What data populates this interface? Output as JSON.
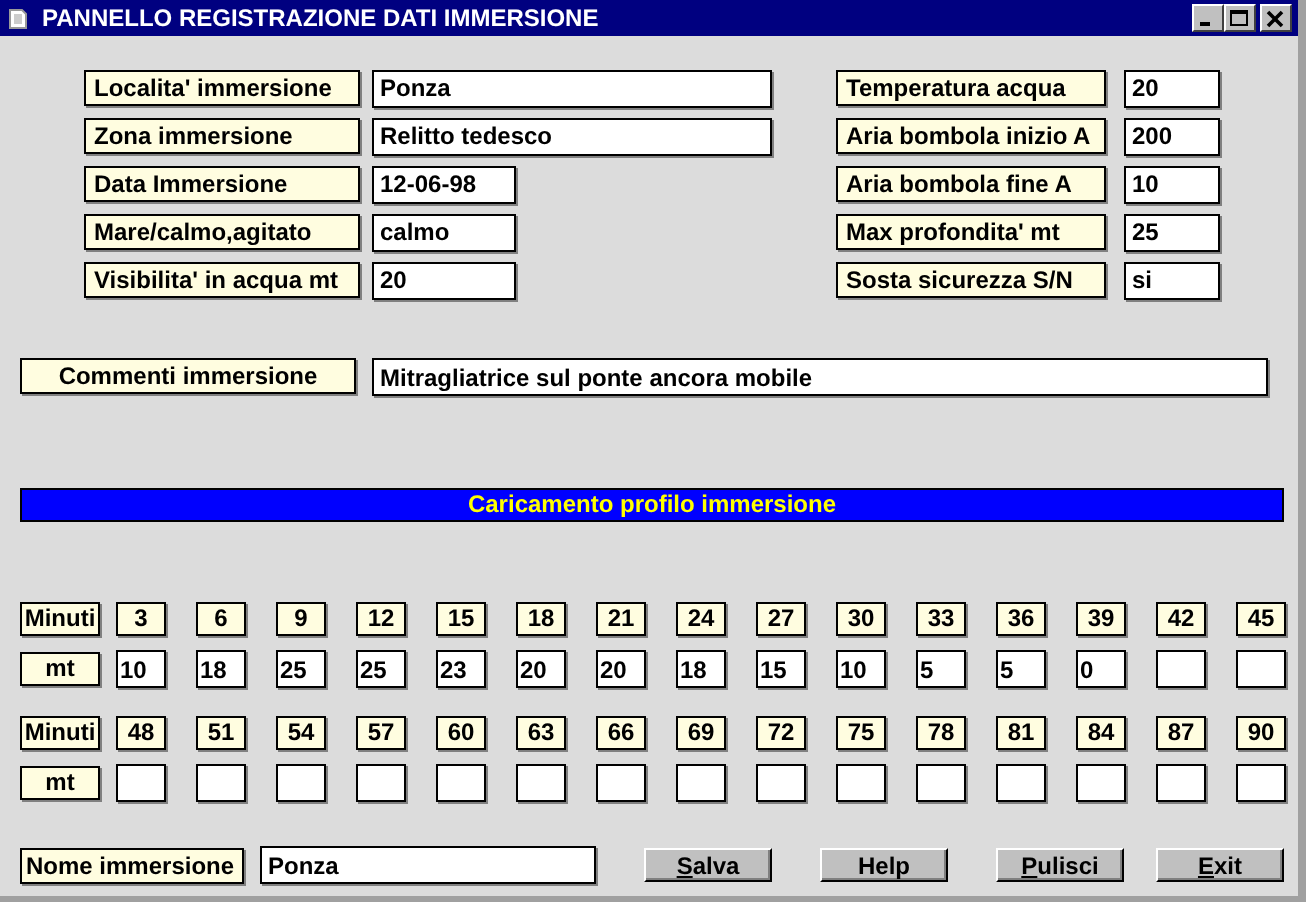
{
  "window": {
    "title": "PANNELLO REGISTRAZIONE DATI IMMERSIONE"
  },
  "left_fields": [
    {
      "label": "Localita' immersione",
      "value": "Ponza",
      "kind": "long"
    },
    {
      "label": "Zona immersione",
      "value": "Relitto tedesco",
      "kind": "long"
    },
    {
      "label": "Data Immersione",
      "value": "12-06-98",
      "kind": "short"
    },
    {
      "label": "Mare/calmo,agitato",
      "value": "calmo",
      "kind": "short"
    },
    {
      "label": "Visibilita' in acqua mt",
      "value": "20",
      "kind": "short"
    }
  ],
  "right_fields": [
    {
      "label": "Temperatura acqua",
      "value": "20"
    },
    {
      "label": "Aria bombola inizio A",
      "value": "200"
    },
    {
      "label": "Aria bombola fine A",
      "value": "10"
    },
    {
      "label": "Max profondita' mt",
      "value": "25"
    },
    {
      "label": "Sosta sicurezza S/N",
      "value": "si"
    }
  ],
  "comment": {
    "label": "Commenti immersione",
    "value": "Mitragliatrice sul ponte ancora mobile"
  },
  "section_header": "Caricamento profilo immersione",
  "profile_blocks": [
    {
      "minutes_label": "Minuti",
      "depth_label": "mt",
      "minutes": [
        "3",
        "6",
        "9",
        "12",
        "15",
        "18",
        "21",
        "24",
        "27",
        "30",
        "33",
        "36",
        "39",
        "42",
        "45"
      ],
      "depths": [
        "10",
        "18",
        "25",
        "25",
        "23",
        "20",
        "20",
        "18",
        "15",
        "10",
        "5",
        "5",
        "0"
      ]
    },
    {
      "minutes_label": "Minuti",
      "depth_label": "mt",
      "minutes": [
        "48",
        "51",
        "54",
        "57",
        "60",
        "63",
        "66",
        "69",
        "72",
        "75",
        "78",
        "81",
        "84",
        "87",
        "90"
      ]
    }
  ],
  "name_field": {
    "label": "Nome immersione",
    "value": "Ponza"
  },
  "buttons": [
    {
      "label": "Salva",
      "mnemonic": true
    },
    {
      "label": "Help",
      "mnemonic": false
    },
    {
      "label": "Pulisci",
      "mnemonic": true
    },
    {
      "label": "Exit",
      "mnemonic": true
    }
  ]
}
